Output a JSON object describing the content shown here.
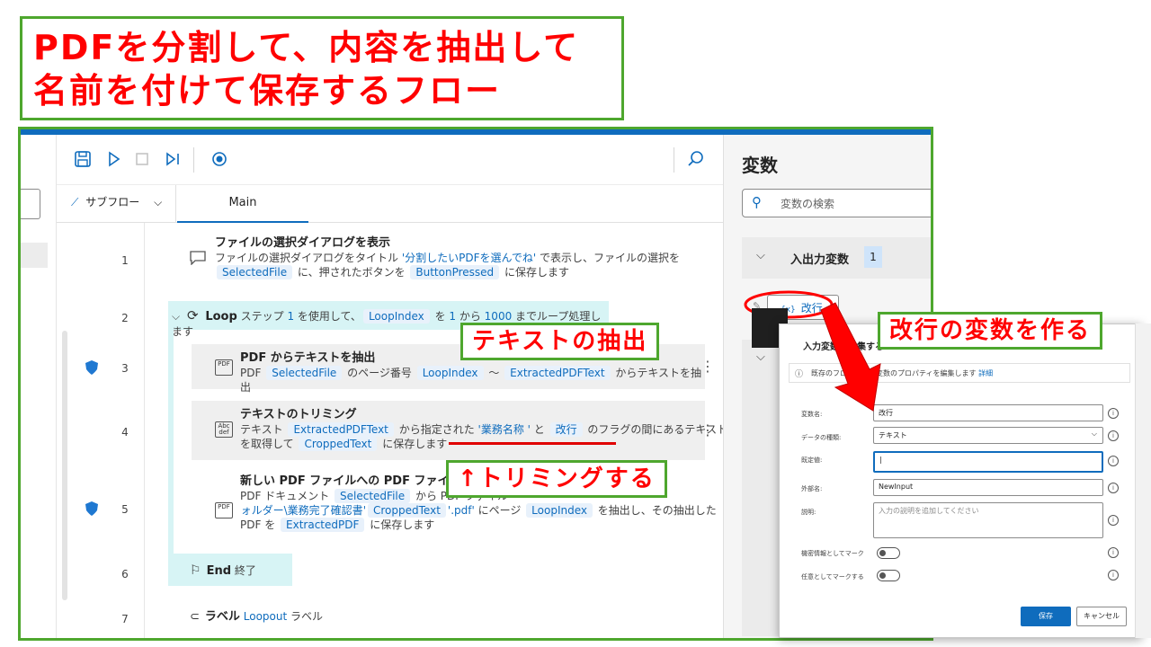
{
  "title": {
    "line1": "PDFを分割して、内容を抽出して",
    "line2": "名前を付けて保存するフロー"
  },
  "designer": {
    "subflow_label": "サブフロー",
    "tab_main": "Main",
    "actions": [
      {
        "line": "1",
        "title": "ファイルの選択ダイアログを表示",
        "a": "ファイルの選択ダイアログをタイトル ",
        "lit": "'分割したいPDFを選んでね'",
        "b": " で表示し、ファイルの選択を",
        "v1": "SelectedFile",
        "c": " に、押されたボタンを ",
        "v2": "ButtonPressed",
        "d": " に保存します"
      },
      {
        "line": "2",
        "kw": "Loop",
        "a": " ステップ ",
        "n1": "1",
        "b": " を使用して、",
        "v1": "LoopIndex",
        "c": " を ",
        "n2": "1",
        "d": " から ",
        "n3": "1000",
        "e": " までループ処理します"
      },
      {
        "line": "3",
        "title": "PDF からテキストを抽出",
        "a": "PDF ",
        "v1": "SelectedFile",
        "b": " のページ番号 ",
        "v2": "LoopIndex",
        "c": " ～ ",
        "v3": "ExtractedPDFText",
        "d": " からテキストを抽出"
      },
      {
        "line": "4",
        "title": "テキストのトリミング",
        "a": "テキスト ",
        "v1": "ExtractedPDFText",
        "b": " から指定された ",
        "lit1": "'業務名称 '",
        "c": " と ",
        "v2": "改行",
        "d": " のフラグの間にあるテキスト",
        "e": "を取得して ",
        "v3": "CroppedText",
        "f": " に保存します"
      },
      {
        "line": "5",
        "title": "新しい PDF ファイルへの PDF ファイル ページの抽出",
        "a": "PDF ドキュメント ",
        "v1": "SelectedFile",
        "b": " から PDF ファイル ",
        "lit1": "'C:\\Users\\フォルダー\\業務完了確認書'",
        "v2": "CroppedText",
        "lit2": "'.pdf'",
        "c": " にページ ",
        "v3": "LoopIndex",
        "d": " を抽出し、その抽出した",
        "e": "PDF を ",
        "v4": "ExtractedPDF",
        "f": " に保存します"
      },
      {
        "line": "6",
        "kw": "End",
        "a": " 終了"
      },
      {
        "line": "7",
        "kw": "ラベル",
        "lit1": "Loopout",
        "a": " ラベル"
      }
    ]
  },
  "variables": {
    "title": "変数",
    "search_placeholder": "変数の検索",
    "section_io": "入出力変数",
    "io_count": "1",
    "var_item_prefix": "{x}",
    "var_item": "改行"
  },
  "dialog": {
    "title": "入力変数の編集する",
    "note": "既存のフローは出力変数のプロパティを編集します",
    "note_link": "詳細",
    "labels": {
      "name": "変数名:",
      "type": "データの種類:",
      "default": "既定値:",
      "external": "外部名:",
      "desc": "説明:",
      "sensitive": "機密情報としてマーク",
      "optional": "任意としてマークする"
    },
    "values": {
      "name": "改行",
      "type": "テキスト",
      "default": "|",
      "external": "NewInput",
      "desc_placeholder": "入力の説明を追加してください"
    },
    "save": "保存",
    "cancel": "キャンセル"
  },
  "callouts": {
    "extract": "テキストの抽出",
    "trim": "↑トリミングする",
    "make_var": "改行の変数を作る"
  },
  "colors": {
    "accent": "#0f6cbd",
    "callout_red": "#ff0000",
    "callout_border": "#4ea72e",
    "loop_band": "#d7f4f5"
  }
}
